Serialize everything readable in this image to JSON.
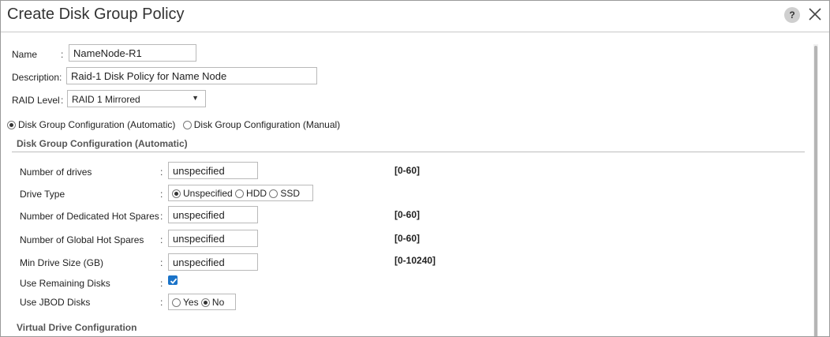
{
  "dialog": {
    "title": "Create Disk Group Policy",
    "help_label": "?"
  },
  "name": {
    "label": "Name",
    "colon": ":",
    "value": "NameNode-R1"
  },
  "description": {
    "label": "Description",
    "colon": ":",
    "value": "Raid-1 Disk Policy for Name Node"
  },
  "raid_level": {
    "label": "RAID Level",
    "colon": ":",
    "selected": "RAID 1 Mirrored"
  },
  "config_mode": {
    "automatic": "Disk Group Configuration (Automatic)",
    "manual": "Disk Group Configuration (Manual)",
    "selected": "automatic"
  },
  "auto_section": {
    "header": "Disk Group Configuration (Automatic)",
    "colon": ":",
    "number_of_drives": {
      "label": "Number of drives",
      "value": "unspecified",
      "range": "[0-60]"
    },
    "drive_type": {
      "label": "Drive Type",
      "options": [
        "Unspecified",
        "HDD",
        "SSD"
      ],
      "selected": "Unspecified"
    },
    "dedicated_hot_spares": {
      "label": "Number of Dedicated Hot Spares",
      "value": "unspecified",
      "range": "[0-60]"
    },
    "global_hot_spares": {
      "label": "Number of Global Hot Spares",
      "value": "unspecified",
      "range": "[0-60]"
    },
    "min_drive_size": {
      "label": "Min Drive Size (GB)",
      "value": "unspecified",
      "range": "[0-10240]"
    },
    "use_remaining_disks": {
      "label": "Use Remaining Disks",
      "checked": true
    },
    "use_jbod_disks": {
      "label": "Use JBOD Disks",
      "options": [
        "Yes",
        "No"
      ],
      "selected": "No"
    }
  },
  "virtual_drive_section": {
    "header": "Virtual Drive Configuration"
  }
}
